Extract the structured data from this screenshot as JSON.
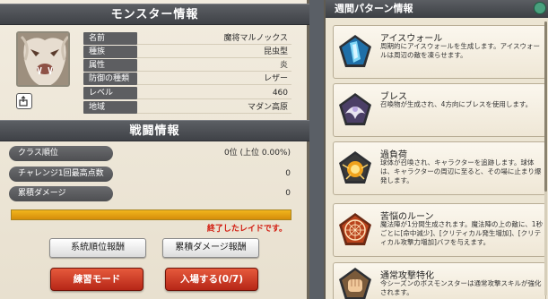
{
  "monster_panel": {
    "title": "モンスター情報",
    "rows": [
      {
        "label": "名前",
        "value": "魔将マルノックス"
      },
      {
        "label": "種族",
        "value": "昆虫型"
      },
      {
        "label": "属性",
        "value": "炎"
      },
      {
        "label": "防御の種類",
        "value": "レザー"
      },
      {
        "label": "レベル",
        "value": "460"
      },
      {
        "label": "地域",
        "value": "マダン高原"
      }
    ]
  },
  "battle_panel": {
    "title": "戦闘情報",
    "stats": [
      {
        "label": "クラス順位",
        "value": "0位 (上位 0.00%)"
      },
      {
        "label": "チャレンジ1回最高点数",
        "value": "0"
      },
      {
        "label": "累積ダメージ",
        "value": "0"
      }
    ],
    "progress": 1.0,
    "raid_status": "終了したレイドです。"
  },
  "buttons": {
    "ranking_reward": "系統順位報酬",
    "damage_reward": "累積ダメージ報酬",
    "practice_mode": "練習モード",
    "enter": "入場する(0/7)"
  },
  "weekly_patterns": {
    "title": "週間パターン情報",
    "items": [
      {
        "title": "アイスウォール",
        "description": "周期的にアイスウォールを生成します。アイスウォールは周辺の敵を凍らせます。",
        "icon": "ice-wall-icon"
      },
      {
        "title": "ブレス",
        "description": "召喚物が生成され、4方向にブレスを使用します。",
        "icon": "breath-icon"
      },
      {
        "title": "過負荷",
        "description": "球体が召喚され、キャラクターを追跡します。球体は、キャラクターの周辺に至ると、その場に止まり爆発します。",
        "icon": "overload-icon"
      },
      {
        "title": "苦悩のルーン",
        "description": "魔法陣が1分間生成されます。魔法陣の上の敵に、1秒ごとに[命中減少]、[クリティカル発生増加]、[クリティカル攻撃力増加]バフを与えます。",
        "icon": "rune-icon"
      },
      {
        "title": "通常攻撃特化",
        "description": "今シーズンのボスモンスターは通常攻撃スキルが強化されます。",
        "icon": "fist-icon"
      }
    ]
  },
  "colors": {
    "accent_red": "#d21b0f",
    "progress": "#e7a313",
    "header": "#4a4d52"
  }
}
